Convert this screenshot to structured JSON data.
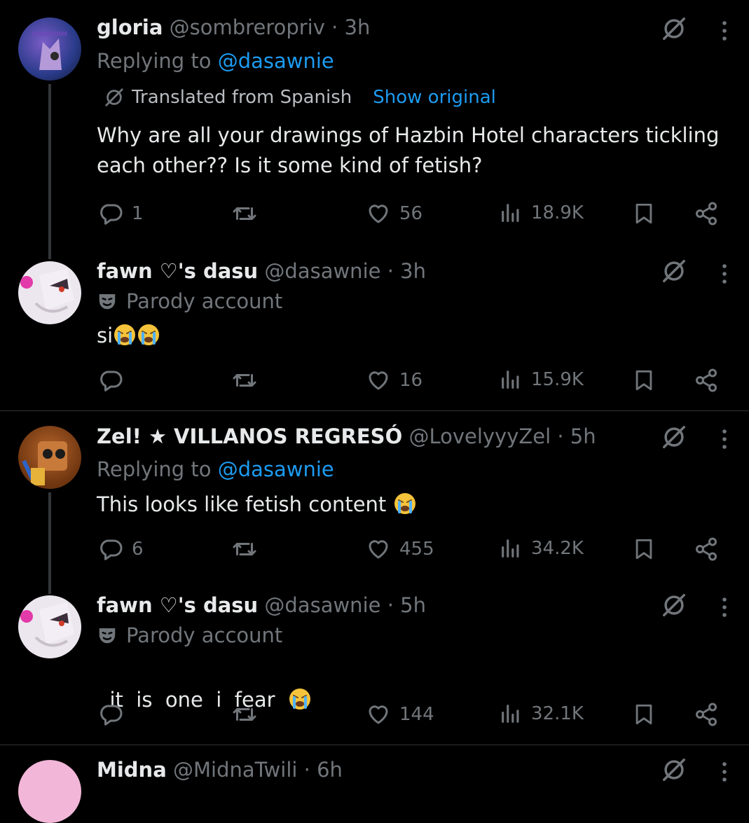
{
  "tweets": [
    {
      "name": "gloria",
      "handle": "@sombreropriv",
      "time": "· 3h",
      "replying_prefix": "Replying to",
      "replying_to": "@dasawnie",
      "translated_label": "Translated from Spanish",
      "show_original": "Show original",
      "text": "Why are all your drawings of Hazbin Hotel characters tickling each other?? Is it some kind of fetish?",
      "replies": "1",
      "reposts": "",
      "likes": "56",
      "views": "18.9K"
    },
    {
      "name": "fawn ♡'s dasu",
      "handle": "@dasawnie",
      "time": "· 3h",
      "parody": "Parody account",
      "text": "si",
      "replies": "",
      "reposts": "",
      "likes": "16",
      "views": "15.9K"
    },
    {
      "name": "Zel! ★ VILLANOS REGRESÓ",
      "handle": "@LovelyyyZel",
      "time": "· 5h",
      "replying_prefix": "Replying to",
      "replying_to": "@dasawnie",
      "text": "This looks like fetish content",
      "replies": "6",
      "reposts": "",
      "likes": "455",
      "views": "34.2K"
    },
    {
      "name": "fawn ♡'s dasu",
      "handle": "@dasawnie",
      "time": "· 5h",
      "parody": "Parody account",
      "text": "it  is  one  i  fear",
      "replies": "",
      "reposts": "",
      "likes": "144",
      "views": "32.1K"
    },
    {
      "name": "Midna",
      "handle": "@MidnaTwili",
      "time": "· 6h"
    }
  ],
  "icons": {
    "reply": "reply-icon",
    "repost": "repost-icon",
    "like": "heart-icon",
    "views": "views-icon",
    "bookmark": "bookmark-icon",
    "share": "share-icon",
    "grok": "grok-icon",
    "more": "more-icon",
    "emoji": "loudly-crying-face-emoji",
    "parody": "theater-mask-icon"
  },
  "colors": {
    "background": "#000000",
    "text": "#e7e9ea",
    "muted": "#71767b",
    "link": "#1d9bf0",
    "divider": "#2f3336"
  }
}
